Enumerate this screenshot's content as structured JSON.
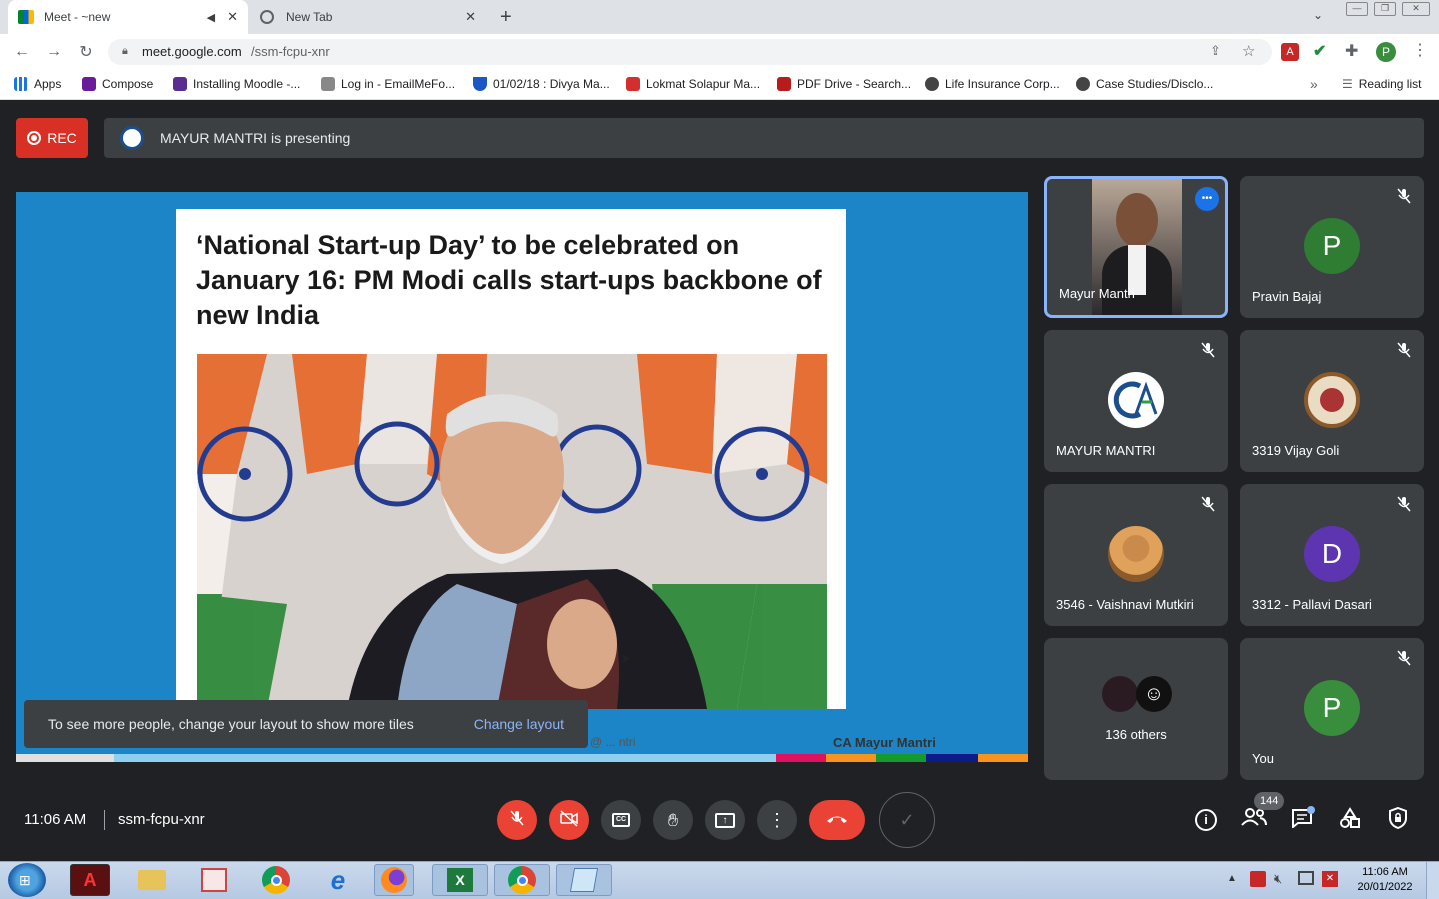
{
  "browser": {
    "tabs": [
      {
        "title": "Meet - ~new"
      },
      {
        "title": "New Tab"
      }
    ],
    "url_host": "meet.google.com",
    "url_path": "/ssm-fcpu-xnr",
    "bookmarks": [
      {
        "label": "Apps",
        "icon": "apps-grid-icon",
        "color": "#1a73e8"
      },
      {
        "label": "Compose",
        "icon": "mail-icon",
        "color": "#6a1b9a"
      },
      {
        "label": "Installing Moodle -...",
        "icon": "moodle-icon",
        "color": "#5c2d91"
      },
      {
        "label": "Log in - EmailMeFo...",
        "icon": "emailmeform-icon",
        "color": "#888888"
      },
      {
        "label": "01/02/18 : Divya Ma...",
        "icon": "shield-icon",
        "color": "#1a57c5"
      },
      {
        "label": "Lokmat Solapur Ma...",
        "icon": "lokmat-icon",
        "color": "#d32f2f"
      },
      {
        "label": "PDF Drive - Search...",
        "icon": "pdf-drive-icon",
        "color": "#b71c1c"
      },
      {
        "label": "Life Insurance Corp...",
        "icon": "globe-icon",
        "color": "#444444"
      },
      {
        "label": "Case Studies/Disclo...",
        "icon": "globe-icon",
        "color": "#444444"
      }
    ],
    "reading_list": "Reading list",
    "profile_initial": "P"
  },
  "meet": {
    "rec_label": "REC",
    "presenting_text": "MAYUR MANTRI is presenting",
    "slide": {
      "headline": "‘National Start-up Day’ to be celebrated on January 16: PM Modi calls start-ups backbone of new India",
      "footer_left": "@ ... ntri",
      "footer_right": "CA Mayur Mantri"
    },
    "toast": {
      "text": "To see more people, change your layout to show more tiles",
      "action": "Change layout"
    },
    "participants": [
      {
        "name": "Mayur Mantri",
        "type": "video",
        "speaking": true
      },
      {
        "name": "Pravin Bajaj",
        "type": "initial",
        "initial": "P",
        "color": "#2e7d32",
        "muted": true
      },
      {
        "name": "MAYUR MANTRI",
        "type": "logo",
        "muted": true
      },
      {
        "name": "3319 Vijay Goli",
        "type": "emblem",
        "muted": true
      },
      {
        "name": "3546 - Vaishnavi Mutkiri",
        "type": "photo",
        "muted": true
      },
      {
        "name": "3312 - Pallavi Dasari",
        "type": "initial",
        "initial": "D",
        "color": "#5e35b1",
        "muted": true
      },
      {
        "name": "136 others",
        "type": "others"
      },
      {
        "name": "You",
        "type": "initial",
        "initial": "P",
        "color": "#388e3c",
        "muted": true
      }
    ],
    "time": "11:06 AM",
    "meeting_code": "ssm-fcpu-xnr",
    "people_count": "144"
  },
  "taskbar": {
    "time": "11:06 AM",
    "date": "20/01/2022"
  },
  "colors": {
    "meet_bg": "#202124",
    "tile_bg": "#3c4043",
    "stage_blue": "#1b85c8",
    "danger": "#ea4335",
    "link_blue": "#8ab4f8"
  }
}
